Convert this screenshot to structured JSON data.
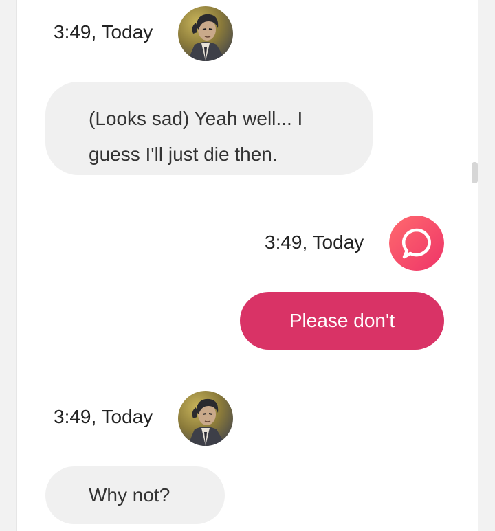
{
  "colors": {
    "outgoing_bubble": "#d93366",
    "incoming_bubble": "#f0f0f0",
    "app_icon_gradient": [
      "#ff5a6e",
      "#f03a6a"
    ]
  },
  "messages": [
    {
      "sender": "character",
      "timestamp": "3:49, Today",
      "text": "(Looks sad) Yeah well... I guess I'll just die then.",
      "avatar_icon": "character-avatar"
    },
    {
      "sender": "user",
      "timestamp": "3:49, Today",
      "text": "Please don't",
      "avatar_icon": "chat-bubble-icon"
    },
    {
      "sender": "character",
      "timestamp": "3:49, Today",
      "text": "Why not?",
      "avatar_icon": "character-avatar"
    }
  ]
}
